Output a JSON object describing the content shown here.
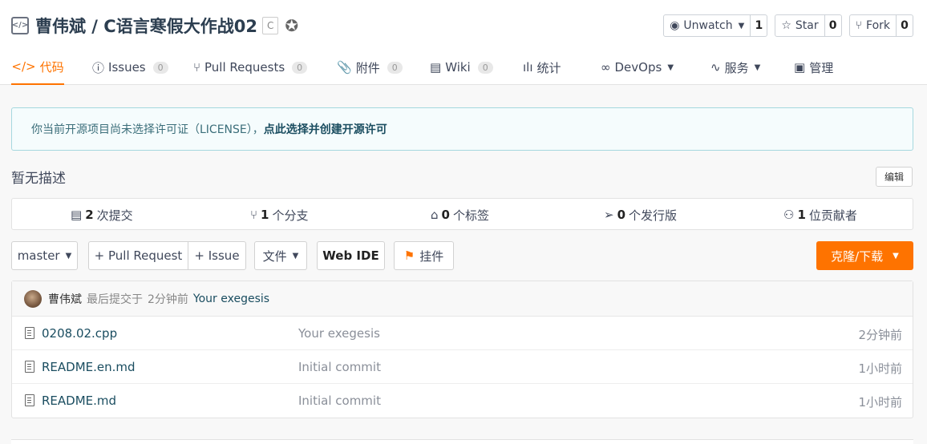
{
  "repo": {
    "title": "曹伟斌 / C语言寒假大作战02",
    "language": "C"
  },
  "actions": {
    "watch": {
      "label": "Unwatch",
      "count": "1"
    },
    "star": {
      "label": "Star",
      "count": "0"
    },
    "fork": {
      "label": "Fork",
      "count": "0"
    }
  },
  "tabs": [
    {
      "label": "代码",
      "count": ""
    },
    {
      "label": "Issues",
      "count": "0"
    },
    {
      "label": "Pull Requests",
      "count": "0"
    },
    {
      "label": "附件",
      "count": "0"
    },
    {
      "label": "Wiki",
      "count": "0"
    },
    {
      "label": "统计",
      "count": ""
    },
    {
      "label": "DevOps",
      "count": ""
    },
    {
      "label": "服务",
      "count": ""
    },
    {
      "label": "管理",
      "count": ""
    }
  ],
  "license": {
    "text": "你当前开源项目尚未选择许可证（LICENSE），",
    "link": "点此选择并创建开源许可"
  },
  "description": "暂无描述",
  "edit_label": "编辑",
  "stats": [
    {
      "count": "2",
      "label": "次提交"
    },
    {
      "count": "1",
      "label": "个分支"
    },
    {
      "count": "0",
      "label": "个标签"
    },
    {
      "count": "0",
      "label": "个发行版"
    },
    {
      "count": "1",
      "label": "位贡献者"
    }
  ],
  "buttons": {
    "branch": "master",
    "pull_request": "+ Pull Request",
    "issue": "+ Issue",
    "file": "文件",
    "web_ide": "Web IDE",
    "widget": "挂件",
    "clone": "克隆/下载"
  },
  "last_commit": {
    "author": "曹伟斌",
    "prefix": "最后提交于",
    "time": "2分钟前",
    "message": "Your exegesis"
  },
  "files": [
    {
      "name": "0208.02.cpp",
      "message": "Your exegesis",
      "time": "2分钟前"
    },
    {
      "name": "README.en.md",
      "message": "Initial commit",
      "time": "1小时前"
    },
    {
      "name": "README.md",
      "message": "Initial commit",
      "time": "1小时前"
    }
  ],
  "colors": {
    "accent": "#fe7300",
    "link": "#1a4d60",
    "license_bg": "#f5fcfd"
  }
}
